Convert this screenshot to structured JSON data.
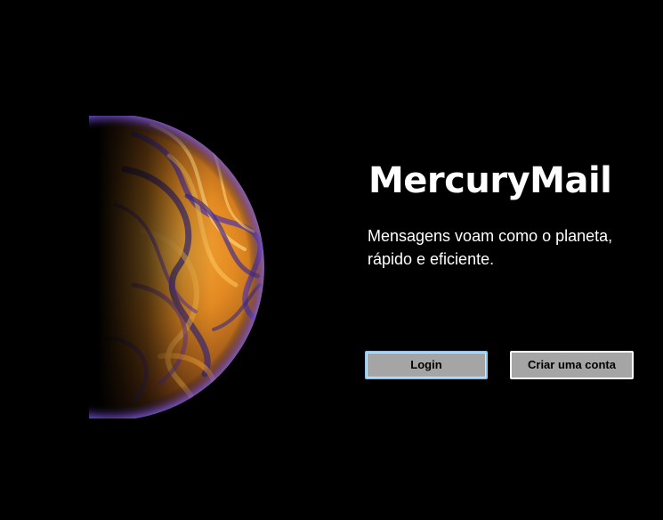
{
  "app": {
    "title": "MercuryMail",
    "tagline_line1": "Mensagens voam como o planeta,",
    "tagline_line2": "rápido e eficiente."
  },
  "buttons": {
    "login_label": "Login",
    "signup_label": "Criar uma conta"
  },
  "colors": {
    "background": "#000000",
    "text": "#ffffff",
    "button_bg": "#a5a5a5",
    "focus_border": "#8ec8f0",
    "planet_orange": "#f5a033",
    "planet_purple": "#4a2f8a"
  },
  "icons": {
    "planet": "mercury-planet-illustration"
  }
}
